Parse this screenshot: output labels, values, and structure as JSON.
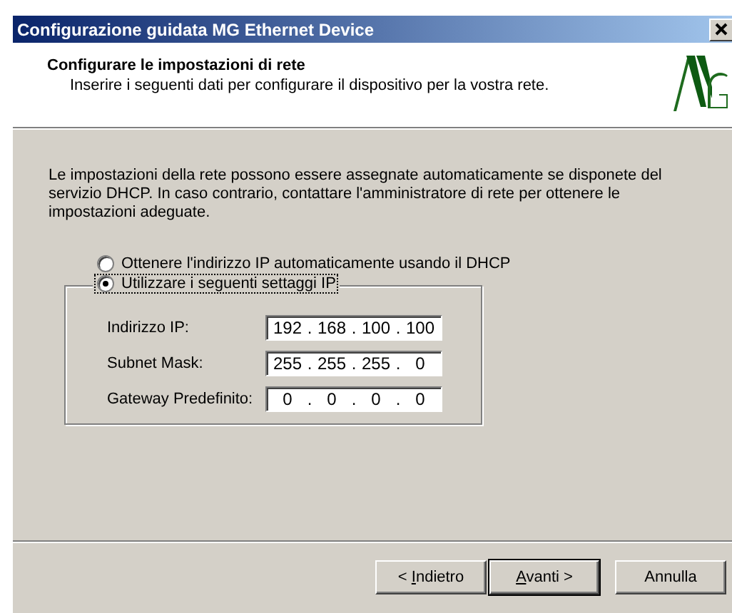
{
  "window": {
    "title": "Configurazione guidata MG Ethernet Device"
  },
  "header": {
    "title": "Configurare le impostazioni di rete",
    "subtitle": "Inserire i seguenti dati per configurare il dispositivo per la vostra rete."
  },
  "intro": "Le impostazioni della rete possono essere assegnate automaticamente se disponete del servizio DHCP.  In caso contrario, contattare l'amministratore di rete per ottenere le impostazioni adeguate.",
  "options": [
    {
      "label": "Ottenere l'indirizzo IP automaticamente usando il DHCP",
      "selected": false,
      "focused": false
    },
    {
      "label": "Utilizzare i seguenti settaggi IP",
      "selected": true,
      "focused": true
    }
  ],
  "fields": [
    {
      "label": "Indirizzo IP:",
      "cells": [
        "192",
        ".",
        "168",
        ".",
        "100",
        ".",
        "100"
      ]
    },
    {
      "label": "Subnet Mask:",
      "cells": [
        "255",
        ".",
        "255",
        ".",
        "255",
        ".",
        "0"
      ]
    },
    {
      "label": "Gateway Predefinito:",
      "cells": [
        "0",
        ".",
        "0",
        ".",
        "0",
        ".",
        "0"
      ]
    }
  ],
  "buttons": [
    {
      "before": "< ",
      "key": "I",
      "after": "ndietro",
      "default": false
    },
    {
      "key": "A",
      "after": "vanti >",
      "default": true
    },
    {
      "before": "Annulla",
      "default": false
    }
  ]
}
